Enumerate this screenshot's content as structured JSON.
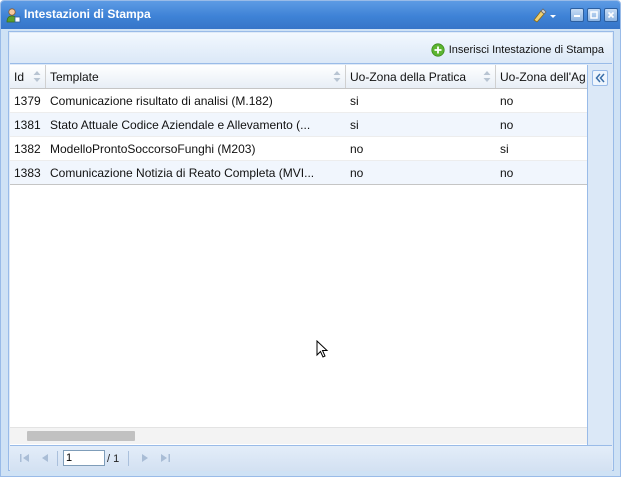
{
  "window": {
    "title": "Intestazioni di Stampa"
  },
  "toolbar": {
    "insert_label": "Inserisci Intestazione di Stampa"
  },
  "grid": {
    "columns": [
      "Id",
      "Template",
      "Uo-Zona della Pratica",
      "Uo-Zona dell'Ag"
    ],
    "rows": [
      {
        "id": "1379",
        "template": "Comunicazione risultato di analisi (M.182)",
        "zona_pratica": "si",
        "zona_ag": "no"
      },
      {
        "id": "1381",
        "template": "Stato Attuale Codice Aziendale e Allevamento (...",
        "zona_pratica": "si",
        "zona_ag": "no"
      },
      {
        "id": "1382",
        "template": "ModelloProntoSoccorsoFunghi (M203)",
        "zona_pratica": "no",
        "zona_ag": "si"
      },
      {
        "id": "1383",
        "template": "Comunicazione Notizia di Reato Completa (MVI...",
        "zona_pratica": "no",
        "zona_ag": "no"
      }
    ]
  },
  "pager": {
    "page": "1",
    "of": "/ 1"
  },
  "colors": {
    "titlebar": "#3e82d6",
    "border": "#99bbe8",
    "alt_row": "#f1f6fd"
  }
}
